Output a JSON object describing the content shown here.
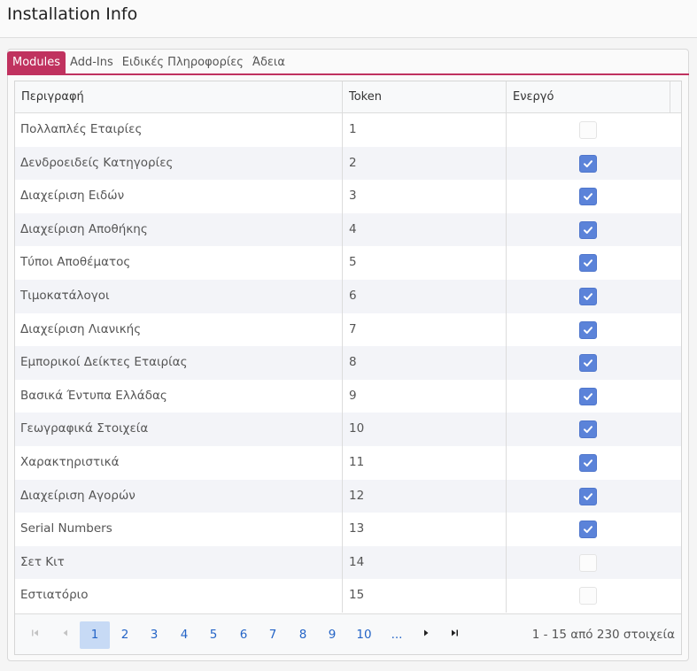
{
  "window": {
    "title": "Installation Info"
  },
  "tabs": [
    {
      "label": "Modules",
      "active": true
    },
    {
      "label": "Add-Ins",
      "active": false
    },
    {
      "label": "Ειδικές Πληροφορίες",
      "active": false
    },
    {
      "label": "Άδεια",
      "active": false
    }
  ],
  "grid": {
    "columns": [
      "Περιγραφή",
      "Token",
      "Ενεργό"
    ],
    "rows": [
      {
        "description": "Πολλαπλές Εταιρίες",
        "token": "1",
        "active": false
      },
      {
        "description": "Δενδροειδείς Κατηγορίες",
        "token": "2",
        "active": true
      },
      {
        "description": "Διαχείριση Ειδών",
        "token": "3",
        "active": true
      },
      {
        "description": "Διαχείριση Αποθήκης",
        "token": "4",
        "active": true
      },
      {
        "description": "Τύποι Αποθέματος",
        "token": "5",
        "active": true
      },
      {
        "description": "Τιμοκατάλογοι",
        "token": "6",
        "active": true
      },
      {
        "description": "Διαχείριση Λιανικής",
        "token": "7",
        "active": true
      },
      {
        "description": "Εμπορικοί Δείκτες Εταιρίας",
        "token": "8",
        "active": true
      },
      {
        "description": "Βασικά Έντυπα Ελλάδας",
        "token": "9",
        "active": true
      },
      {
        "description": "Γεωγραφικά Στοιχεία",
        "token": "10",
        "active": true
      },
      {
        "description": "Χαρακτηριστικά",
        "token": "11",
        "active": true
      },
      {
        "description": "Διαχείριση Αγορών",
        "token": "12",
        "active": true
      },
      {
        "description": "Serial Numbers",
        "token": "13",
        "active": true
      },
      {
        "description": "Σετ Κιτ",
        "token": "14",
        "active": false
      },
      {
        "description": "Εστιατόριο",
        "token": "15",
        "active": false
      }
    ]
  },
  "pager": {
    "pages": [
      "1",
      "2",
      "3",
      "4",
      "5",
      "6",
      "7",
      "8",
      "9",
      "10",
      "..."
    ],
    "current_page": "1",
    "first_icon": "first-page-icon",
    "prev_icon": "previous-page-icon",
    "next_icon": "next-page-icon",
    "last_icon": "last-page-icon",
    "info": "1 - 15 από 230 στοιχεία"
  },
  "colors": {
    "accent": "#c0325f",
    "checkbox_on": "#5b83d9",
    "link": "#2565c7",
    "selected_page": "#c7daf5"
  }
}
